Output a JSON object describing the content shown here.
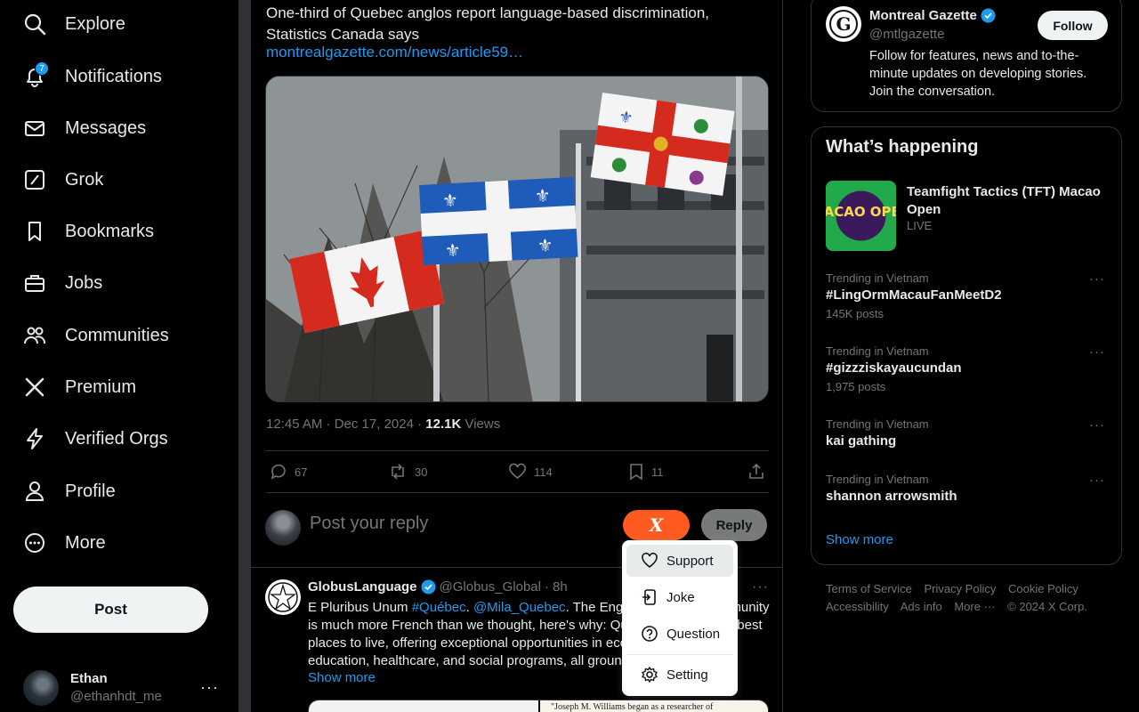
{
  "nav": {
    "items": [
      {
        "label": "Explore",
        "icon": "search-icon"
      },
      {
        "label": "Notifications",
        "icon": "bell-icon",
        "badge": "7"
      },
      {
        "label": "Messages",
        "icon": "envelope-icon"
      },
      {
        "label": "Grok",
        "icon": "grok-icon"
      },
      {
        "label": "Bookmarks",
        "icon": "bookmark-icon"
      },
      {
        "label": "Jobs",
        "icon": "briefcase-icon"
      },
      {
        "label": "Communities",
        "icon": "people-icon"
      },
      {
        "label": "Premium",
        "icon": "x-logo-icon"
      },
      {
        "label": "Verified Orgs",
        "icon": "lightning-icon"
      },
      {
        "label": "Profile",
        "icon": "person-icon"
      },
      {
        "label": "More",
        "icon": "more-circle-icon"
      }
    ],
    "post_label": "Post",
    "account": {
      "name": "Ethan",
      "handle": "@ethanhdt_me"
    }
  },
  "tweet": {
    "text": "One-third of Quebec anglos report language-based discrimination, Statistics Canada says",
    "link": "montrealgazette.com/news/article59…",
    "time": "12:45 AM · Dec 17, 2024",
    "views_count": "12.1K",
    "views_label": "Views",
    "actions": {
      "replies": "67",
      "reposts": "30",
      "likes": "114",
      "bookmarks": "11"
    }
  },
  "reply_box": {
    "placeholder": "Post your reply",
    "x_label": "X",
    "reply_label": "Reply"
  },
  "dropdown": {
    "items": [
      {
        "label": "Support",
        "icon": "heart-icon"
      },
      {
        "label": "Joke",
        "icon": "joke-icon"
      },
      {
        "label": "Question",
        "icon": "question-icon"
      },
      {
        "label": "Setting",
        "icon": "gear-icon"
      }
    ]
  },
  "reply": {
    "name": "GlobusLanguage",
    "handle": "@Globus_Global",
    "time": "8h",
    "text_1": "E Pluribus Unum ",
    "tag": "#Québec",
    "text_2": ". ",
    "mention": "@Mila_Quebec",
    "text_3": ". The English-speaking community is much more French than we thought, here's why: Québec is one of the best places to live, offering exceptional opportunities in economic growth, education, healthcare, and social programs, all grounded in a p",
    "show_more": "Show more",
    "media_quote": "\"Joseph M. Williams began as a researcher of"
  },
  "profile_card": {
    "name": "Montreal Gazette",
    "handle": "@mtlgazette",
    "follow_label": "Follow",
    "bio": "Follow for features, news and to-the-minute updates on developing stories. Join the conversation."
  },
  "happening": {
    "title": "What’s happening",
    "event": {
      "title": "Teamfight Tactics (TFT) Macao Open",
      "status": "LIVE",
      "image_text": "MACAO OPEN"
    },
    "trends": [
      {
        "context": "Trending in Vietnam",
        "title": "#LingOrmMacauFanMeetD2",
        "count": "145K posts"
      },
      {
        "context": "Trending in Vietnam",
        "title": "#gizzziskayaucundan",
        "count": "1,975 posts"
      },
      {
        "context": "Trending in Vietnam",
        "title": "kai gathing",
        "count": ""
      },
      {
        "context": "Trending in Vietnam",
        "title": "shannon arrowsmith",
        "count": ""
      }
    ],
    "show_more": "Show more"
  },
  "footer": {
    "links": [
      "Terms of Service",
      "Privacy Policy",
      "Cookie Policy",
      "Accessibility",
      "Ads info",
      "More ···",
      "© 2024 X Corp."
    ]
  },
  "colors": {
    "accent": "#1d9bf0",
    "x_button": "#ff5a1f",
    "background": "#000000"
  }
}
